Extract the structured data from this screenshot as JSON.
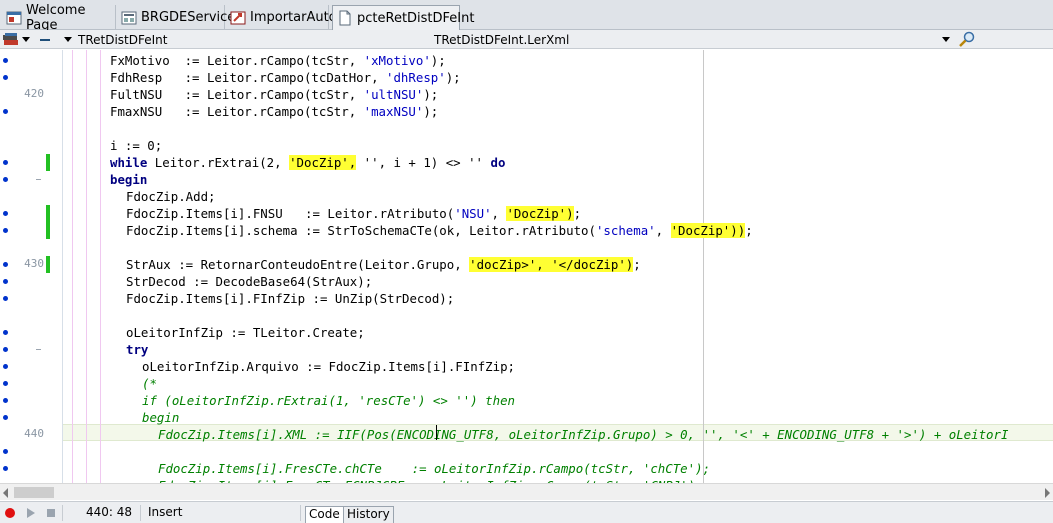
{
  "tabs": [
    {
      "label": "Welcome Page",
      "icon": "welcome-page-icon"
    },
    {
      "label": "BRGDEService",
      "icon": "form-icon"
    },
    {
      "label": "ImportarAuto",
      "icon": "import-icon"
    },
    {
      "label": "pcteRetDistDFeInt",
      "icon": "unit-file-icon"
    }
  ],
  "toolbar": {
    "class_combo": "TRetDistDFeInt",
    "method_combo": "TRetDistDFeInt.LerXml"
  },
  "gutter": {
    "line_numbers": [
      {
        "row": 2,
        "text": "420"
      },
      {
        "row": 12,
        "text": "430"
      },
      {
        "row": 22,
        "text": "440"
      }
    ]
  },
  "status": {
    "position": "440:  48",
    "mode": "Insert",
    "tab_code": "Code",
    "tab_history": "History"
  },
  "colors": {
    "keyword": "#000080",
    "string": "#0000c0",
    "comment": "#008000",
    "highlight": "#ffff33",
    "modified_marker": "#22c022",
    "breakpoint_dot": "#0033cc"
  },
  "code": [
    {
      "indent": 3,
      "segs": [
        [
          "p",
          "FxMotivo  := Leitor.rCampo(tcStr, "
        ],
        [
          "s",
          "'xMotivo'"
        ],
        [
          "p",
          ");"
        ]
      ]
    },
    {
      "indent": 3,
      "segs": [
        [
          "p",
          "FdhResp   := Leitor.rCampo(tcDatHor, "
        ],
        [
          "s",
          "'dhResp'"
        ],
        [
          "p",
          ");"
        ]
      ]
    },
    {
      "indent": 3,
      "segs": [
        [
          "p",
          "FultNSU   := Leitor.rCampo(tcStr, "
        ],
        [
          "s",
          "'ultNSU'"
        ],
        [
          "p",
          ");"
        ]
      ]
    },
    {
      "indent": 3,
      "segs": [
        [
          "p",
          "FmaxNSU   := Leitor.rCampo(tcStr, "
        ],
        [
          "s",
          "'maxNSU'"
        ],
        [
          "p",
          ");"
        ]
      ]
    },
    {
      "indent": 3,
      "segs": []
    },
    {
      "indent": 3,
      "segs": [
        [
          "p",
          "i := 0;"
        ]
      ]
    },
    {
      "indent": 3,
      "segs": [
        [
          "k",
          "while"
        ],
        [
          "p",
          " Leitor.rExtrai(2, "
        ],
        [
          "h",
          "'DocZip',"
        ],
        [
          "p",
          " '', i + 1) <> '' "
        ],
        [
          "k",
          "do"
        ]
      ]
    },
    {
      "indent": 3,
      "segs": [
        [
          "k",
          "begin"
        ]
      ]
    },
    {
      "indent": 4,
      "segs": [
        [
          "p",
          "FdocZip.Add;"
        ]
      ]
    },
    {
      "indent": 4,
      "segs": [
        [
          "p",
          "FdocZip.Items[i].FNSU   := Leitor.rAtributo("
        ],
        [
          "s",
          "'NSU'"
        ],
        [
          "p",
          ", "
        ],
        [
          "h",
          "'DocZip')"
        ],
        [
          "p",
          ";"
        ]
      ]
    },
    {
      "indent": 4,
      "segs": [
        [
          "p",
          "FdocZip.Items[i].schema := StrToSchemaCTe(ok, Leitor.rAtributo("
        ],
        [
          "s",
          "'schema'"
        ],
        [
          "p",
          ", "
        ],
        [
          "h",
          "'DocZip'))"
        ],
        [
          "p",
          ";"
        ]
      ]
    },
    {
      "indent": 4,
      "segs": []
    },
    {
      "indent": 4,
      "segs": [
        [
          "p",
          "StrAux := RetornarConteudoEntre(Leitor.Grupo, "
        ],
        [
          "h",
          "'docZip>', '</docZip')"
        ],
        [
          "p",
          ";"
        ]
      ]
    },
    {
      "indent": 4,
      "segs": [
        [
          "p",
          "StrDecod := DecodeBase64(StrAux);"
        ]
      ]
    },
    {
      "indent": 4,
      "segs": [
        [
          "p",
          "FdocZip.Items[i].FInfZip := UnZip(StrDecod);"
        ]
      ]
    },
    {
      "indent": 4,
      "segs": []
    },
    {
      "indent": 4,
      "segs": [
        [
          "p",
          "oLeitorInfZip := TLeitor.Create;"
        ]
      ]
    },
    {
      "indent": 4,
      "segs": [
        [
          "k",
          "try"
        ]
      ]
    },
    {
      "indent": 5,
      "segs": [
        [
          "p",
          "oLeitorInfZip.Arquivo := FdocZip.Items[i].FInfZip;"
        ]
      ]
    },
    {
      "indent": 5,
      "segs": [
        [
          "c",
          "(*"
        ]
      ]
    },
    {
      "indent": 5,
      "segs": [
        [
          "c",
          "if (oLeitorInfZip.rExtrai(1, 'resCTe') <> '') then"
        ]
      ]
    },
    {
      "indent": 5,
      "segs": [
        [
          "c",
          "begin"
        ]
      ]
    },
    {
      "indent": 6,
      "segs": [
        [
          "c",
          "FdocZip.Items[i].XML := IIF(Pos(ENCODING_UTF8, oLeitorInfZip.Grupo) > 0, '', '<' + ENCODING_UTF8 + '>') + oLeitorI"
        ]
      ]
    },
    {
      "indent": 6,
      "segs": []
    },
    {
      "indent": 6,
      "segs": [
        [
          "c",
          "FdocZip.Items[i].FresCTe.chCTe    := oLeitorInfZip.rCampo(tcStr, 'chCTe');"
        ]
      ]
    },
    {
      "indent": 6,
      "segs": [
        [
          "c",
          "FdocZip.Items[i].FresCTe.FCNPJCPF := oLeitorInfZip.rCampo(tcStr, 'CNPJ');"
        ]
      ]
    }
  ]
}
